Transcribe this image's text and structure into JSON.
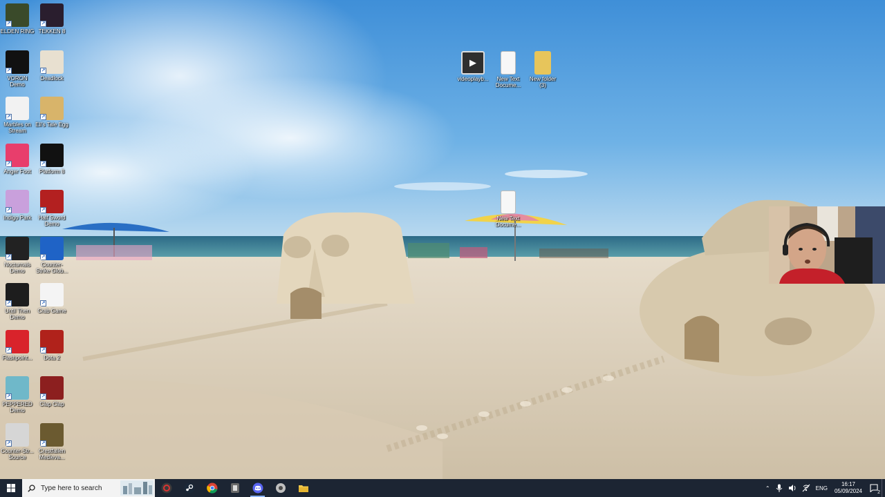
{
  "desktop": {
    "icons": [
      {
        "label": "ELDEN RING",
        "icon": "elden-ring-icon",
        "color": "#3a4a2a"
      },
      {
        "label": "TEKKEN 8",
        "icon": "tekken8-icon",
        "color": "#2a1e2e"
      },
      {
        "label": "VORON Demo",
        "icon": "voron-icon",
        "color": "#111111"
      },
      {
        "label": "Deadlock",
        "icon": "deadlock-icon",
        "color": "#e8e0d0"
      },
      {
        "label": "Marbles on Stream",
        "icon": "marbles-icon",
        "color": "#f2f2f2"
      },
      {
        "label": "Eli's Tale Egg",
        "icon": "egg-icon",
        "color": "#d8b46a"
      },
      {
        "label": "Anger Foot",
        "icon": "anger-foot-icon",
        "color": "#e83e6c"
      },
      {
        "label": "Platform 8",
        "icon": "platform8-icon",
        "color": "#111111"
      },
      {
        "label": "Indigo Park",
        "icon": "indigo-park-icon",
        "color": "#c9a0dc"
      },
      {
        "label": "Half Sword Demo",
        "icon": "half-sword-icon",
        "color": "#b32020"
      },
      {
        "label": "Nocturnals Demo",
        "icon": "nocturnals-icon",
        "color": "#222222"
      },
      {
        "label": "Counter-Strike Glob...",
        "icon": "csgo-icon",
        "color": "#1f63c6"
      },
      {
        "label": "Until Then Demo",
        "icon": "until-then-icon",
        "color": "#1d1d1d"
      },
      {
        "label": "Crab Game",
        "icon": "crab-game-icon",
        "color": "#f4f4f4"
      },
      {
        "label": "Flashpoint...",
        "icon": "flashpoint-icon",
        "color": "#d9232b"
      },
      {
        "label": "Dota 2",
        "icon": "dota2-icon",
        "color": "#b0221b"
      },
      {
        "label": "PEPPERED Demo",
        "icon": "peppered-icon",
        "color": "#6fb8c9"
      },
      {
        "label": "Clap Clap",
        "icon": "clap-clap-icon",
        "color": "#8c1f1f"
      },
      {
        "label": "Counter-Str... Source",
        "icon": "cs-source-icon",
        "color": "#d6d6d6"
      },
      {
        "label": "Crestfallen Medieva...",
        "icon": "crestfallen-icon",
        "color": "#6b5a30"
      }
    ],
    "files": [
      {
        "label": "videoplayb...",
        "icon": "video-file-icon"
      },
      {
        "label": "New Text Docume...",
        "icon": "text-file-icon"
      },
      {
        "label": "New folder (3)",
        "icon": "folder-icon"
      },
      {
        "label": "New Text Docume...",
        "icon": "text-file-icon"
      }
    ]
  },
  "taskbar": {
    "search_placeholder": "Type here to search",
    "apps": [
      {
        "name": "obs-icon",
        "color": "#3b3b3b"
      },
      {
        "name": "steam-icon",
        "color": "#1b2838"
      },
      {
        "name": "chrome-icon",
        "color": "#db4437"
      },
      {
        "name": "game-launcher-icon",
        "color": "#6a6a6a"
      },
      {
        "name": "discord-icon",
        "color": "#5865f2"
      },
      {
        "name": "app-settings-icon",
        "color": "#bfbfbf"
      },
      {
        "name": "file-explorer-icon",
        "color": "#f2c94c"
      }
    ],
    "tray": {
      "language": "ENG",
      "time": "16:17",
      "date": "05/09/2024",
      "notification_count": "2"
    }
  }
}
